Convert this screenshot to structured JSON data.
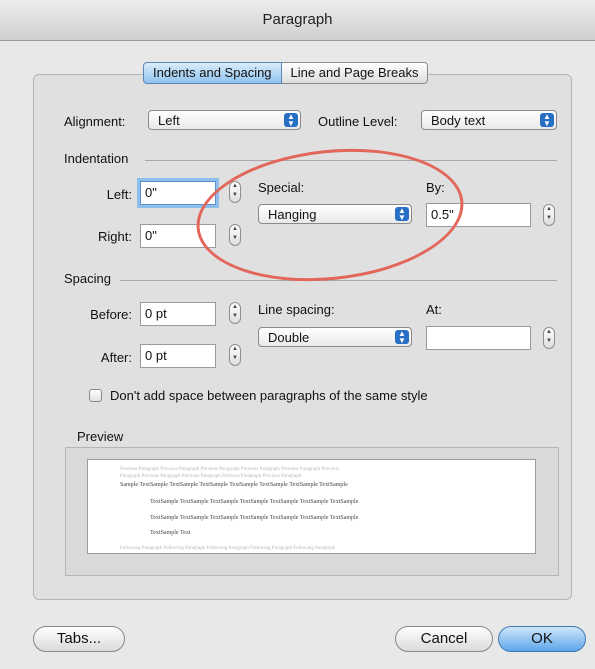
{
  "window": {
    "title": "Paragraph"
  },
  "tabs": [
    {
      "label": "Indents and Spacing",
      "selected": true
    },
    {
      "label": "Line and Page Breaks",
      "selected": false
    }
  ],
  "general": {
    "alignment_label": "Alignment:",
    "alignment_value": "Left",
    "outline_label": "Outline Level:",
    "outline_value": "Body text"
  },
  "indentation": {
    "section_label": "Indentation",
    "left_label": "Left:",
    "left_value": "0\"",
    "right_label": "Right:",
    "right_value": "0\"",
    "special_label": "Special:",
    "special_value": "Hanging",
    "by_label": "By:",
    "by_value": "0.5\""
  },
  "spacing": {
    "section_label": "Spacing",
    "before_label": "Before:",
    "before_value": "0 pt",
    "after_label": "After:",
    "after_value": "0 pt",
    "line_spacing_label": "Line spacing:",
    "line_spacing_value": "Double",
    "at_label": "At:",
    "at_value": ""
  },
  "checkbox": {
    "label": "Don't add space between paragraphs of the same style",
    "checked": false
  },
  "preview": {
    "label": "Preview",
    "lines": [
      "Previous Paragraph Previous Paragraph Previous Paragraph Previous Paragraph Previous Paragraph Previous",
      "Paragraph Previous Paragraph Previous Paragraph Previous Paragraph Previous Paragraph",
      "Sample TextSample TextSample TextSample TextSample TextSample TextSample TextSample",
      "TextSample TextSample TextSample TextSample TextSample TextSample TextSample",
      "TextSample TextSample TextSample TextSample TextSample TextSample TextSample",
      "TextSample Text",
      "Following Paragraph Following Paragraph Following Paragraph Following Paragraph Following Paragraph"
    ]
  },
  "buttons": {
    "tabs": "Tabs...",
    "cancel": "Cancel",
    "ok": "OK"
  },
  "colors": {
    "accent": "#2a6fc6",
    "annotation": "#e2665a",
    "focus_ring": "#8fbfec"
  },
  "icons": {
    "popup_arrows": "updown-arrows-icon",
    "stepper": "stepper-icon"
  }
}
